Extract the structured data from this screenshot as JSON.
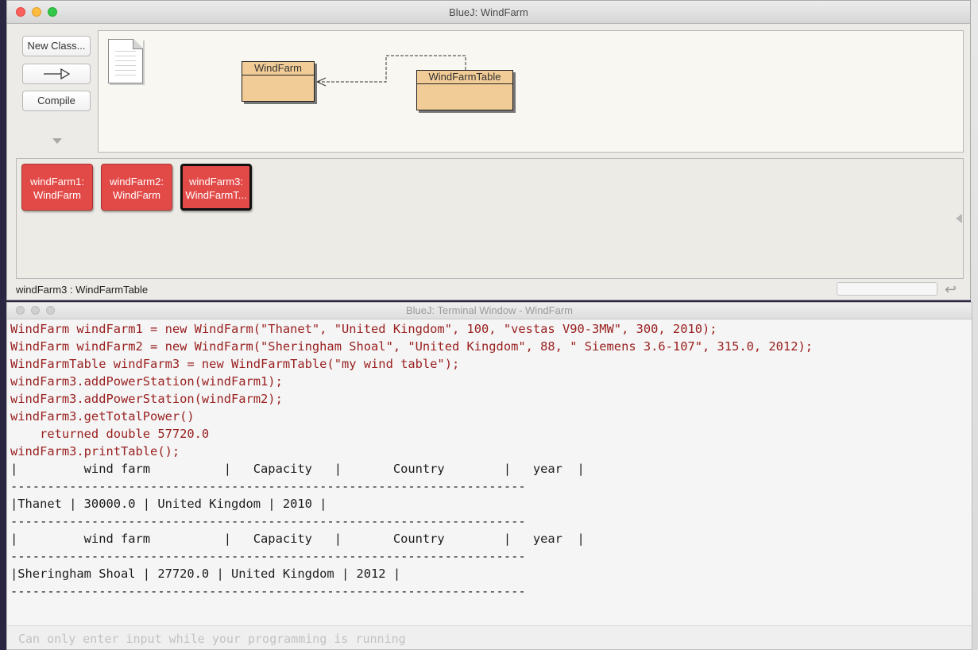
{
  "main_window": {
    "title": "BlueJ:  WindFarm",
    "toolbar": {
      "new_class_label": "New Class...",
      "arrow_label": "—▷",
      "compile_label": "Compile"
    },
    "classes": [
      {
        "name": "WindFarm"
      },
      {
        "name": "WindFarmTable"
      }
    ],
    "objects": [
      {
        "line1": "windFarm1:",
        "line2": "WindFarm"
      },
      {
        "line1": "windFarm2:",
        "line2": "WindFarm"
      },
      {
        "line1": "windFarm3:",
        "line2": "WindFarmT..."
      }
    ],
    "status": "windFarm3 : WindFarmTable"
  },
  "terminal": {
    "title": "BlueJ: Terminal Window - WindFarm",
    "lines": [
      {
        "type": "code",
        "text": "WindFarm windFarm1 = new WindFarm(\"Thanet\", \"United Kingdom\", 100, \"vestas V90-3MW\", 300, 2010);"
      },
      {
        "type": "code",
        "text": "WindFarm windFarm2 = new WindFarm(\"Sheringham Shoal\", \"United Kingdom\", 88, \" Siemens 3.6-107\", 315.0, 2012);"
      },
      {
        "type": "code",
        "text": "WindFarmTable windFarm3 = new WindFarmTable(\"my wind table\");"
      },
      {
        "type": "code",
        "text": "windFarm3.addPowerStation(windFarm1);"
      },
      {
        "type": "code",
        "text": "windFarm3.addPowerStation(windFarm2);"
      },
      {
        "type": "code",
        "text": "windFarm3.getTotalPower()"
      },
      {
        "type": "code",
        "text": "    returned double 57720.0"
      },
      {
        "type": "code",
        "text": "windFarm3.printTable();"
      },
      {
        "type": "out",
        "text": "|         wind farm          |   Capacity   |       Country        |   year  |"
      },
      {
        "type": "out",
        "text": "----------------------------------------------------------------------"
      },
      {
        "type": "out",
        "text": "|Thanet | 30000.0 | United Kingdom | 2010 |"
      },
      {
        "type": "out",
        "text": "----------------------------------------------------------------------"
      },
      {
        "type": "out",
        "text": "|         wind farm          |   Capacity   |       Country        |   year  |"
      },
      {
        "type": "out",
        "text": "----------------------------------------------------------------------"
      },
      {
        "type": "out",
        "text": "|Sheringham Shoal | 27720.0 | United Kingdom | 2012 |"
      },
      {
        "type": "out",
        "text": "----------------------------------------------------------------------"
      }
    ],
    "input_placeholder": "Can only enter input while your programming is running"
  },
  "icons": {
    "document": "readme-document-icon",
    "reset": "reset-icon"
  }
}
